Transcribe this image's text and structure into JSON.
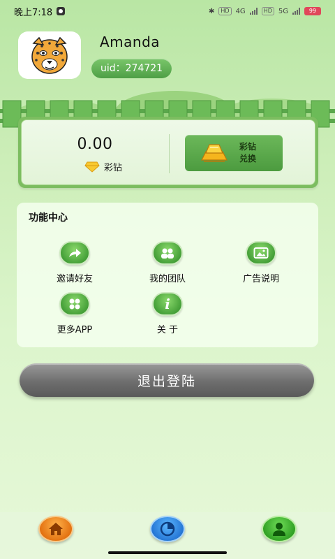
{
  "status_bar": {
    "time": "晚上7:18",
    "network_1": "HD",
    "network_2": "4G",
    "network_3": "HD",
    "network_4": "5G",
    "battery": "99"
  },
  "profile": {
    "username": "Amanda",
    "uid": "uid：274721",
    "avatar_icon": "cheetah-avatar-icon"
  },
  "wallet": {
    "balance": "0.00",
    "currency_label": "彩钻",
    "exchange_label_1": "彩钻",
    "exchange_label_2": "兑换"
  },
  "function_center": {
    "title": "功能中心",
    "items": [
      {
        "label": "邀请好友",
        "icon": "share-arrow-icon"
      },
      {
        "label": "我的团队",
        "icon": "team-icon"
      },
      {
        "label": "广告说明",
        "icon": "image-icon"
      },
      {
        "label": "更多APP",
        "icon": "apps-grid-icon"
      },
      {
        "label": "关 于",
        "icon": "info-icon"
      }
    ]
  },
  "logout": {
    "label": "退出登陆"
  },
  "bottom_nav": {
    "items": [
      {
        "icon": "home-icon"
      },
      {
        "icon": "chart-icon"
      },
      {
        "icon": "profile-icon"
      }
    ]
  },
  "colors": {
    "accent_green": "#4e9f46",
    "logout_grey": "#6e6e6e",
    "home_orange": "#e06a0a",
    "chart_blue": "#1f6fd0"
  }
}
